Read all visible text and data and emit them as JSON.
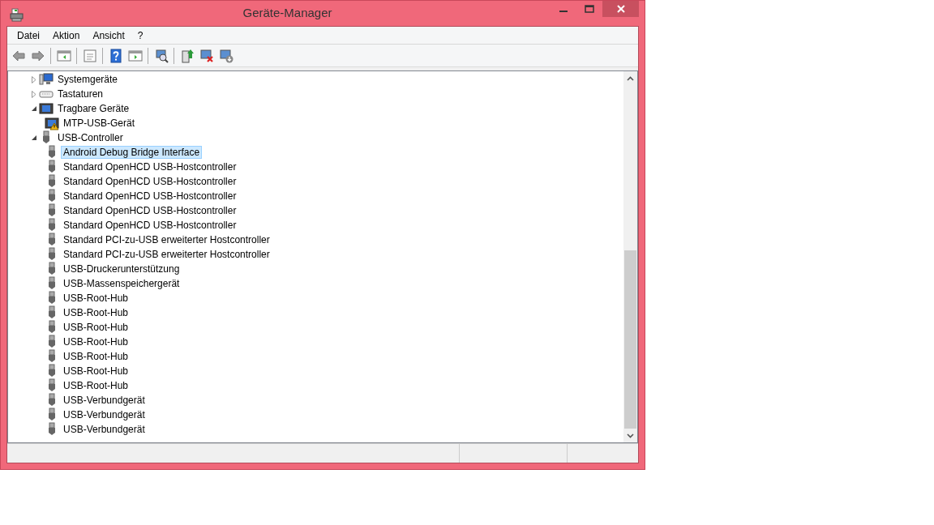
{
  "window": {
    "title": "Geräte-Manager"
  },
  "menu": [
    "Datei",
    "Aktion",
    "Ansicht",
    "?"
  ],
  "tree": [
    {
      "label": "Systemgeräte",
      "kind": "computer",
      "expanded": false
    },
    {
      "label": "Tastaturen",
      "kind": "keyboard",
      "expanded": false
    },
    {
      "label": "Tragbare Geräte",
      "kind": "portable",
      "expanded": true,
      "children": [
        {
          "label": "MTP-USB-Gerät",
          "kind": "portable",
          "warning": true,
          "selected": false
        }
      ]
    },
    {
      "label": "USB-Controller",
      "kind": "usb",
      "expanded": true,
      "children": [
        {
          "label": "Android Debug Bridge Interface",
          "kind": "usb",
          "warning": false,
          "selected": true
        },
        {
          "label": "Standard OpenHCD USB-Hostcontroller",
          "kind": "usb",
          "warning": false,
          "selected": false
        },
        {
          "label": "Standard OpenHCD USB-Hostcontroller",
          "kind": "usb",
          "warning": false,
          "selected": false
        },
        {
          "label": "Standard OpenHCD USB-Hostcontroller",
          "kind": "usb",
          "warning": false,
          "selected": false
        },
        {
          "label": "Standard OpenHCD USB-Hostcontroller",
          "kind": "usb",
          "warning": false,
          "selected": false
        },
        {
          "label": "Standard OpenHCD USB-Hostcontroller",
          "kind": "usb",
          "warning": false,
          "selected": false
        },
        {
          "label": "Standard PCI-zu-USB erweiterter Hostcontroller",
          "kind": "usb",
          "warning": false,
          "selected": false
        },
        {
          "label": "Standard PCI-zu-USB erweiterter Hostcontroller",
          "kind": "usb",
          "warning": false,
          "selected": false
        },
        {
          "label": "USB-Druckerunterstützung",
          "kind": "usb",
          "warning": false,
          "selected": false
        },
        {
          "label": "USB-Massenspeichergerät",
          "kind": "usb",
          "warning": false,
          "selected": false
        },
        {
          "label": "USB-Root-Hub",
          "kind": "usb",
          "warning": false,
          "selected": false
        },
        {
          "label": "USB-Root-Hub",
          "kind": "usb",
          "warning": false,
          "selected": false
        },
        {
          "label": "USB-Root-Hub",
          "kind": "usb",
          "warning": false,
          "selected": false
        },
        {
          "label": "USB-Root-Hub",
          "kind": "usb",
          "warning": false,
          "selected": false
        },
        {
          "label": "USB-Root-Hub",
          "kind": "usb",
          "warning": false,
          "selected": false
        },
        {
          "label": "USB-Root-Hub",
          "kind": "usb",
          "warning": false,
          "selected": false
        },
        {
          "label": "USB-Root-Hub",
          "kind": "usb",
          "warning": false,
          "selected": false
        },
        {
          "label": "USB-Verbundgerät",
          "kind": "usb",
          "warning": false,
          "selected": false
        },
        {
          "label": "USB-Verbundgerät",
          "kind": "usb",
          "warning": false,
          "selected": false
        },
        {
          "label": "USB-Verbundgerät",
          "kind": "usb",
          "warning": false,
          "selected": false
        }
      ]
    }
  ]
}
